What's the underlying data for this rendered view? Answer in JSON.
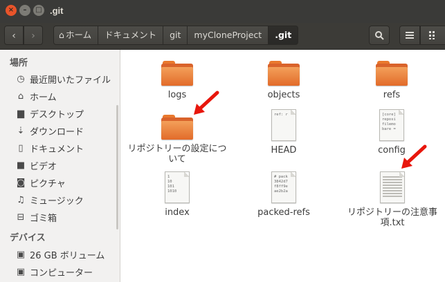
{
  "window": {
    "title": ".git",
    "buttons": {
      "close": "×",
      "minimize": "–",
      "maximize": "□"
    }
  },
  "toolbar": {
    "back_glyph": "‹",
    "forward_glyph": "›",
    "breadcrumbs": [
      "ホーム",
      "ドキュメント",
      "git",
      "myCloneProject",
      ".git"
    ],
    "search_glyph": "⌕",
    "list_glyph": "≡",
    "grid_glyph": "⋮⋮"
  },
  "sidebar": {
    "places_header": "場所",
    "places": [
      {
        "label": "最近開いたファイル",
        "icon": "clock-icon",
        "glyph": "◷"
      },
      {
        "label": "ホーム",
        "icon": "home-icon",
        "glyph": "⌂"
      },
      {
        "label": "デスクトップ",
        "icon": "desktop-icon",
        "glyph": "▆"
      },
      {
        "label": "ダウンロード",
        "icon": "download-icon",
        "glyph": "⇣"
      },
      {
        "label": "ドキュメント",
        "icon": "document-icon",
        "glyph": "▯"
      },
      {
        "label": "ビデオ",
        "icon": "video-icon",
        "glyph": "■"
      },
      {
        "label": "ピクチャ",
        "icon": "camera-icon",
        "glyph": "◙"
      },
      {
        "label": "ミュージック",
        "icon": "music-icon",
        "glyph": "♫"
      },
      {
        "label": "ゴミ箱",
        "icon": "trash-icon",
        "glyph": "⊟"
      }
    ],
    "devices_header": "デバイス",
    "devices": [
      {
        "label": "26 GB ボリューム",
        "icon": "drive-icon",
        "glyph": "▣"
      },
      {
        "label": "コンピューター",
        "icon": "computer-icon",
        "glyph": "▣"
      }
    ]
  },
  "files": [
    {
      "name": "logs",
      "kind": "folder"
    },
    {
      "name": "objects",
      "kind": "folder"
    },
    {
      "name": "refs",
      "kind": "folder"
    },
    {
      "name": "リポジトリーの設定について",
      "kind": "folder"
    },
    {
      "name": "HEAD",
      "kind": "text",
      "preview": [
        "ref: r"
      ]
    },
    {
      "name": "config",
      "kind": "text",
      "preview": [
        "[core]",
        "reposi",
        "filemo",
        "bare ="
      ]
    },
    {
      "name": "index",
      "kind": "text",
      "preview": [
        "1",
        "10",
        "101",
        "1010"
      ]
    },
    {
      "name": "packed-refs",
      "kind": "text",
      "preview": [
        "# pack",
        "3842d7",
        "f8ff9e",
        "ae2b2a"
      ]
    },
    {
      "name": "リポジトリーの注意事項.txt",
      "kind": "document",
      "preview": []
    }
  ],
  "colors": {
    "titlebar": "#3a3a38",
    "close_button": "#e9542a",
    "folder": "#e26b2a",
    "annotation_arrow": "#e8160c"
  }
}
